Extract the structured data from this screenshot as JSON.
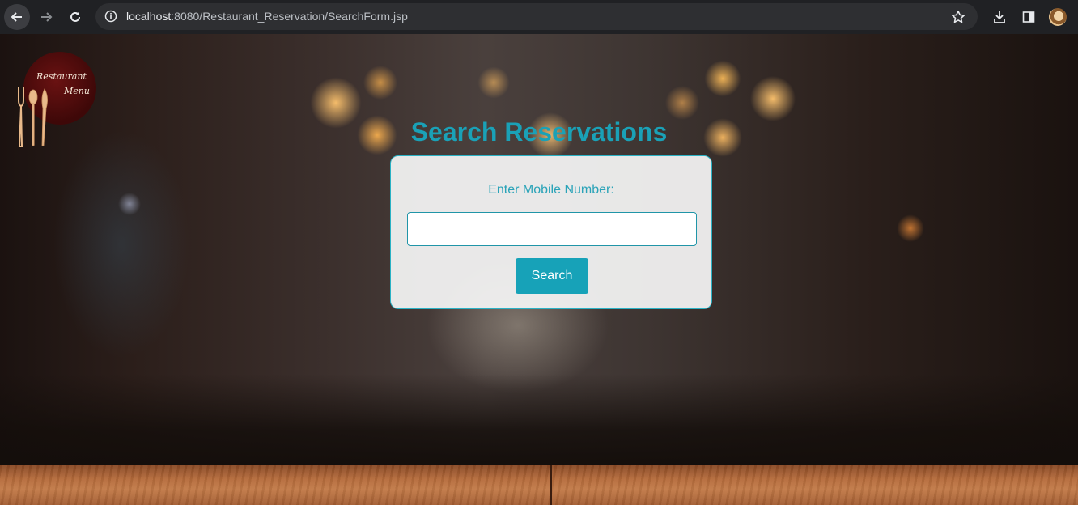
{
  "browser": {
    "url_host": "localhost",
    "url_path": ":8080/Restaurant_Reservation/SearchForm.jsp"
  },
  "logo": {
    "line1": "Restaurant",
    "line2": "Menu"
  },
  "page": {
    "title": "Search Reservations"
  },
  "form": {
    "label": "Enter Mobile Number:",
    "input_value": "",
    "button_label": "Search"
  },
  "colors": {
    "accent": "#17a2b8",
    "title": "#1aa1b7"
  },
  "icons": {
    "back": "arrow-left-icon",
    "forward": "arrow-right-icon",
    "reload": "reload-icon",
    "site_info": "info-icon",
    "bookmark": "star-icon",
    "download": "download-icon",
    "side_panel": "side-panel-icon",
    "profile": "avatar"
  }
}
